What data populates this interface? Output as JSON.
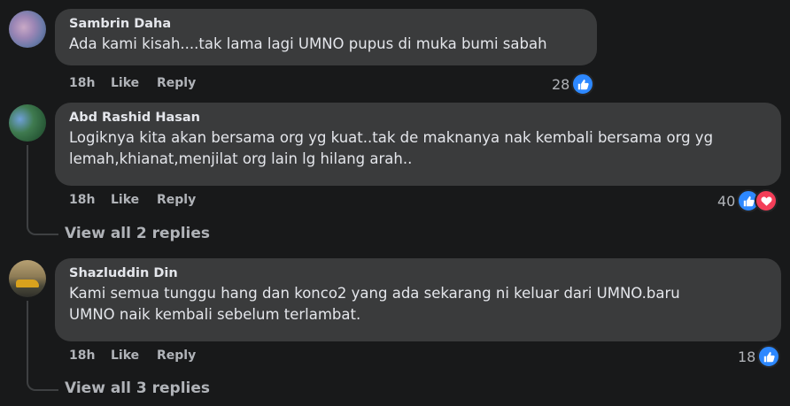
{
  "comments": [
    {
      "author": "Sambrin Daha",
      "text_lines": [
        "Ada kami kisah....tak lama lagi UMNO pupus di muka bumi sabah"
      ],
      "time": "18h",
      "like": "Like",
      "reply": "Reply",
      "reaction_count": "28",
      "reactions": [
        "like"
      ]
    },
    {
      "author": "Abd Rashid Hasan",
      "text_lines": [
        "Logiknya kita akan bersama org yg kuat..tak de maknanya nak kembali bersama org yg",
        "lemah,khianat,menjilat org lain lg hilang arah.."
      ],
      "time": "18h",
      "like": "Like",
      "reply": "Reply",
      "reaction_count": "40",
      "reactions": [
        "like",
        "love"
      ],
      "view_replies": "View all 2 replies"
    },
    {
      "author": "Shazluddin Din",
      "text_lines": [
        "Kami semua tunggu hang dan konco2 yang ada sekarang ni keluar dari UMNO.baru",
        "UMNO naik kembali sebelum terlambat."
      ],
      "time": "18h",
      "like": "Like",
      "reply": "Reply",
      "reaction_count": "18",
      "reactions": [
        "like"
      ],
      "view_replies": "View all 3 replies"
    }
  ],
  "colors": {
    "background": "#18191a",
    "bubble": "#3a3b3c",
    "like_blue": "#2d88ff",
    "love_red": "#f33e58",
    "muted_text": "#b0b3b8"
  }
}
